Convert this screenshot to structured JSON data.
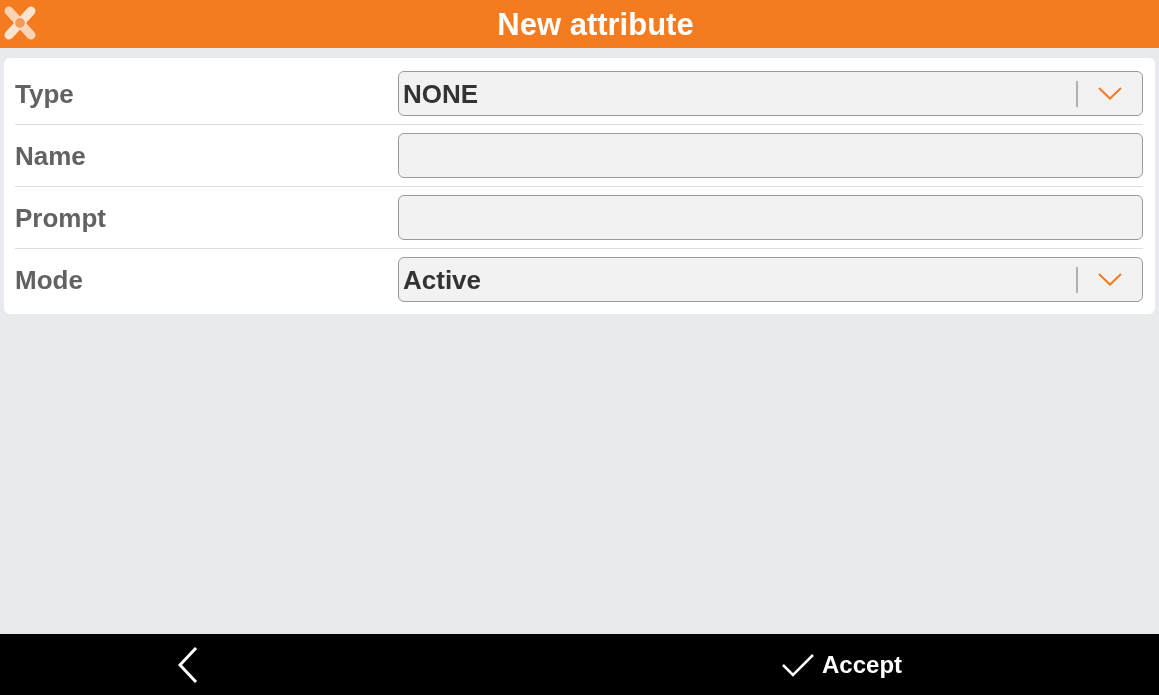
{
  "header": {
    "title": "New attribute"
  },
  "fields": [
    {
      "kind": "select",
      "label": "Type",
      "value": "NONE"
    },
    {
      "kind": "text",
      "label": "Name"
    },
    {
      "kind": "text",
      "label": "Prompt"
    },
    {
      "kind": "select",
      "label": "Mode",
      "value": "Active"
    }
  ],
  "bottom_bar": {
    "accept_label": "Accept"
  }
}
